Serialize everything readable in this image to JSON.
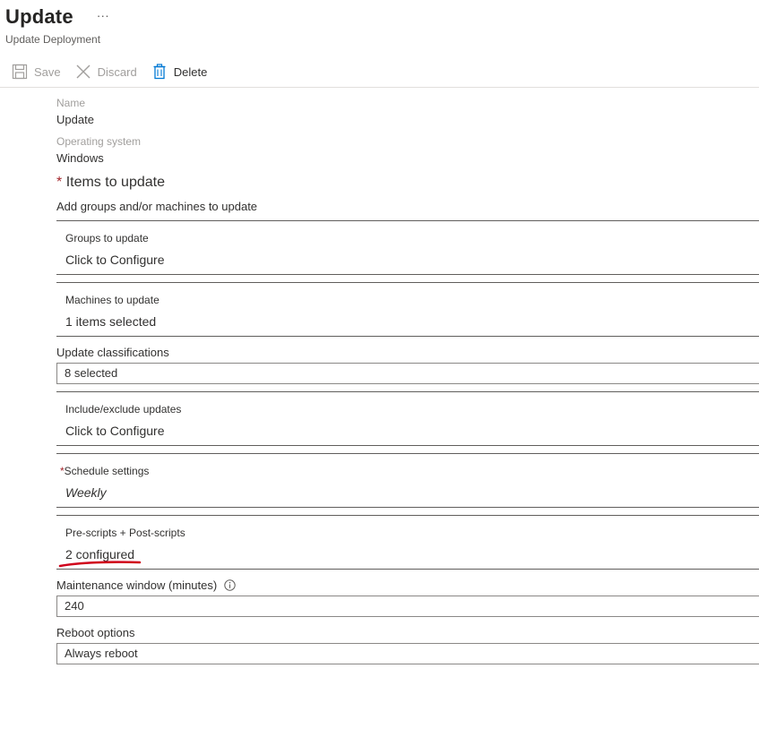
{
  "header": {
    "title": "Update",
    "more": "···",
    "subtitle": "Update Deployment"
  },
  "toolbar": {
    "save_label": "Save",
    "discard_label": "Discard",
    "delete_label": "Delete"
  },
  "fields": {
    "name_label": "Name",
    "name_value": "Update",
    "os_label": "Operating system",
    "os_value": "Windows"
  },
  "items_section": {
    "required_mark": "*",
    "title": "Items to update",
    "description": "Add groups and/or machines to update"
  },
  "groups": {
    "label": "Groups to update",
    "value": "Click to Configure"
  },
  "machines": {
    "label": "Machines to update",
    "value": "1 items selected"
  },
  "classifications": {
    "label": "Update classifications",
    "value": "8 selected"
  },
  "include_exclude": {
    "label": "Include/exclude updates",
    "value": "Click to Configure"
  },
  "schedule": {
    "required_mark": "*",
    "label": "Schedule settings",
    "value": "Weekly"
  },
  "scripts": {
    "label": "Pre-scripts + Post-scripts",
    "value": "2 configured"
  },
  "maintenance": {
    "label": "Maintenance window (minutes)",
    "value": "240"
  },
  "reboot": {
    "label": "Reboot options",
    "value": "Always reboot"
  },
  "colors": {
    "required": "#a4262c",
    "annotation_underline": "#d0021b",
    "delete_icon": "#0078d4",
    "disabled_text": "#a19f9d"
  },
  "icons": [
    "save-icon",
    "close-icon",
    "trash-icon",
    "info-icon"
  ]
}
